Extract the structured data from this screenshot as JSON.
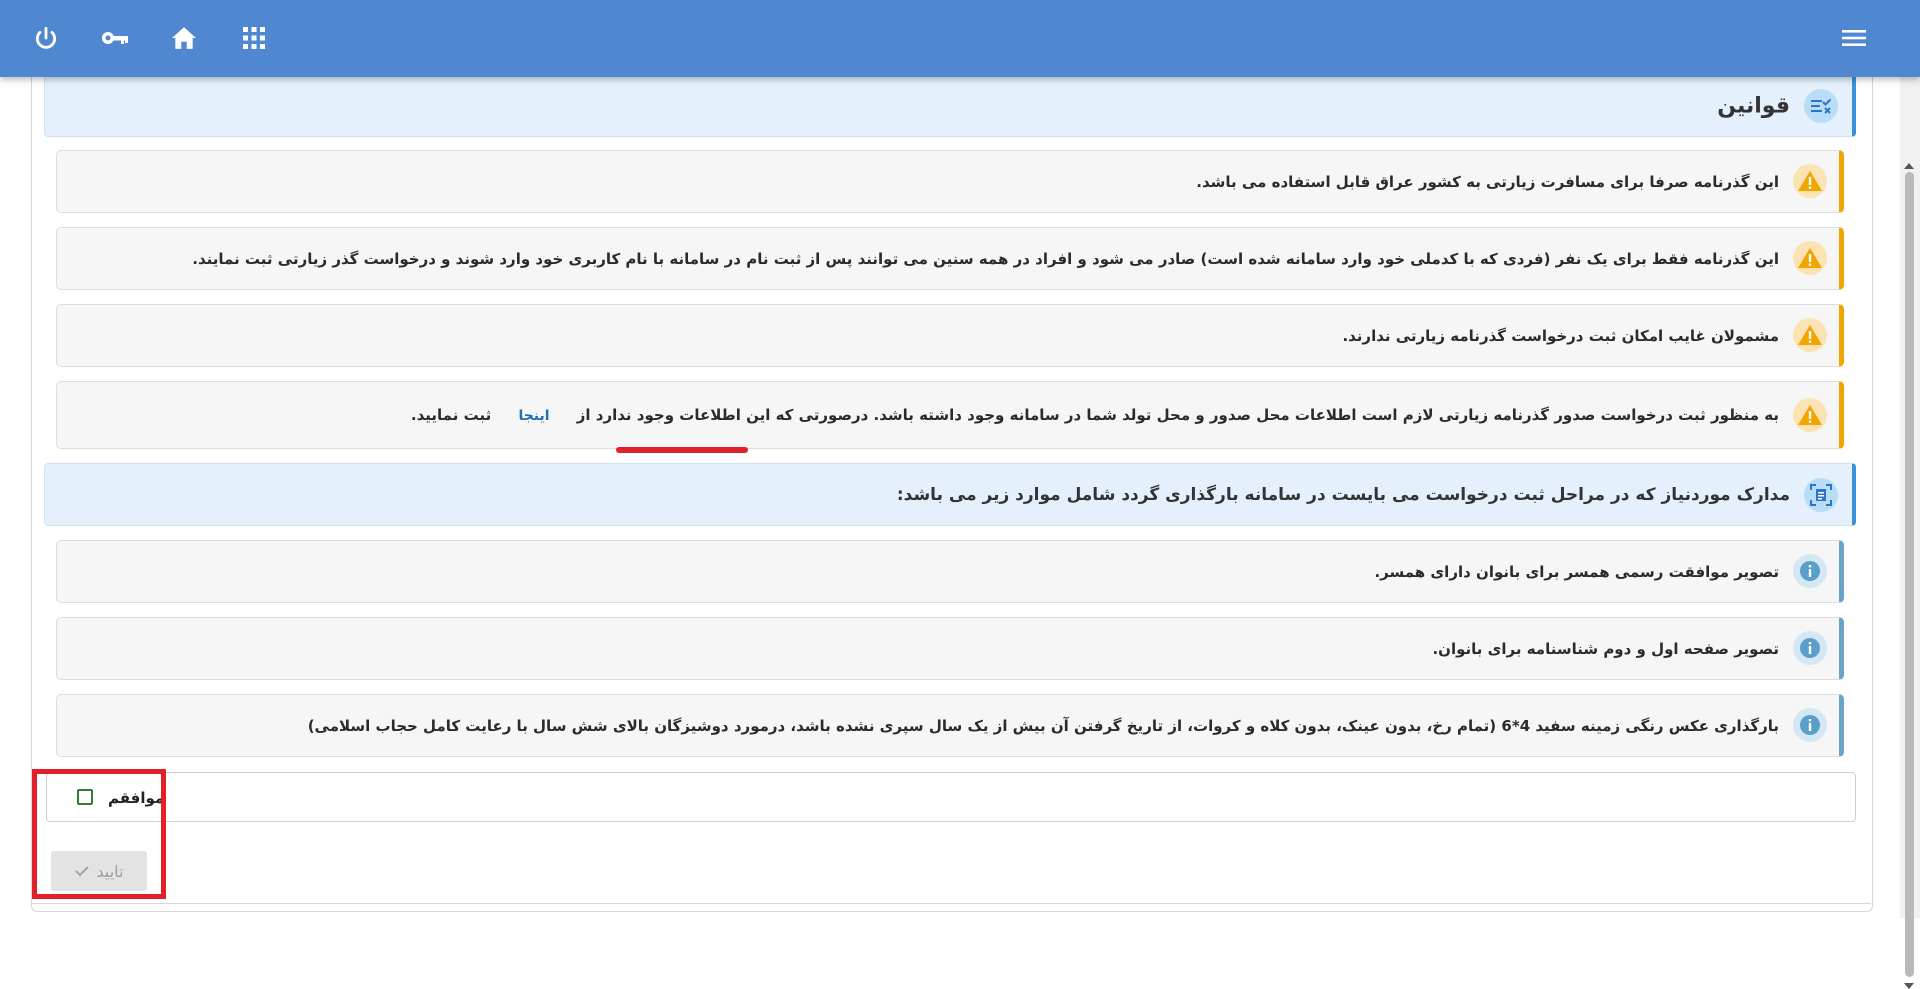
{
  "header": {
    "power_icon": "power-icon",
    "key_icon": "key-icon",
    "home_icon": "home-icon",
    "apps_icon": "apps-grid-icon",
    "menu_icon": "hamburger-menu-icon"
  },
  "rules": {
    "title": "قوانین",
    "items": [
      {
        "text": "این گذرنامه صرفا برای مسافرت زیارتی به کشور عراق قابل استفاده می باشد."
      },
      {
        "text": "این گذرنامه فقط برای یک نفر (فردی که با کدملی خود وارد سامانه شده است) صادر می شود و افراد در همه سنین می توانند پس از ثبت نام در سامانه با نام کاربری خود وارد شوند و درخواست گذر زیارتی ثبت نمایند."
      },
      {
        "text": "مشمولان غایب امکان ثبت درخواست گذرنامه زیارتی ندارند."
      },
      {
        "text_before": "به منظور ثبت درخواست صدور گذرنامه زیارتی لازم است اطلاعات محل صدور و محل تولد شما در سامانه وجود داشته باشد. درصورتی که این اطلاعات وجود ندارد از",
        "link": "اینجا",
        "text_after": "ثبت نمایید."
      }
    ]
  },
  "documents": {
    "title": "مدارک موردنیاز که در مراحل ثبت درخواست می بایست در سامانه بارگذاری گردد شامل موارد زیر می باشد:",
    "items": [
      {
        "text": "تصویر موافقت رسمی همسر برای بانوان دارای همسر."
      },
      {
        "text": "تصویر صفحه اول و دوم شناسنامه برای بانوان."
      },
      {
        "text": "بارگذاری عکس رنگی زمینه سفید 4*6 (تمام رخ، بدون عینک، بدون کلاه و کروات، از تاریخ گرفتن آن بیش از یک سال سپری نشده باشد، درمورد دوشیزگان بالای شش سال با رعایت کامل حجاب اسلامی)"
      }
    ]
  },
  "agreement": {
    "label": "موافقم",
    "checked": false
  },
  "confirm": {
    "label": "تایید",
    "enabled": false
  },
  "colors": {
    "header": "#4f87d1",
    "warning": "#f0a500",
    "info": "#6aa5c9",
    "highlight": "#e0202a"
  }
}
